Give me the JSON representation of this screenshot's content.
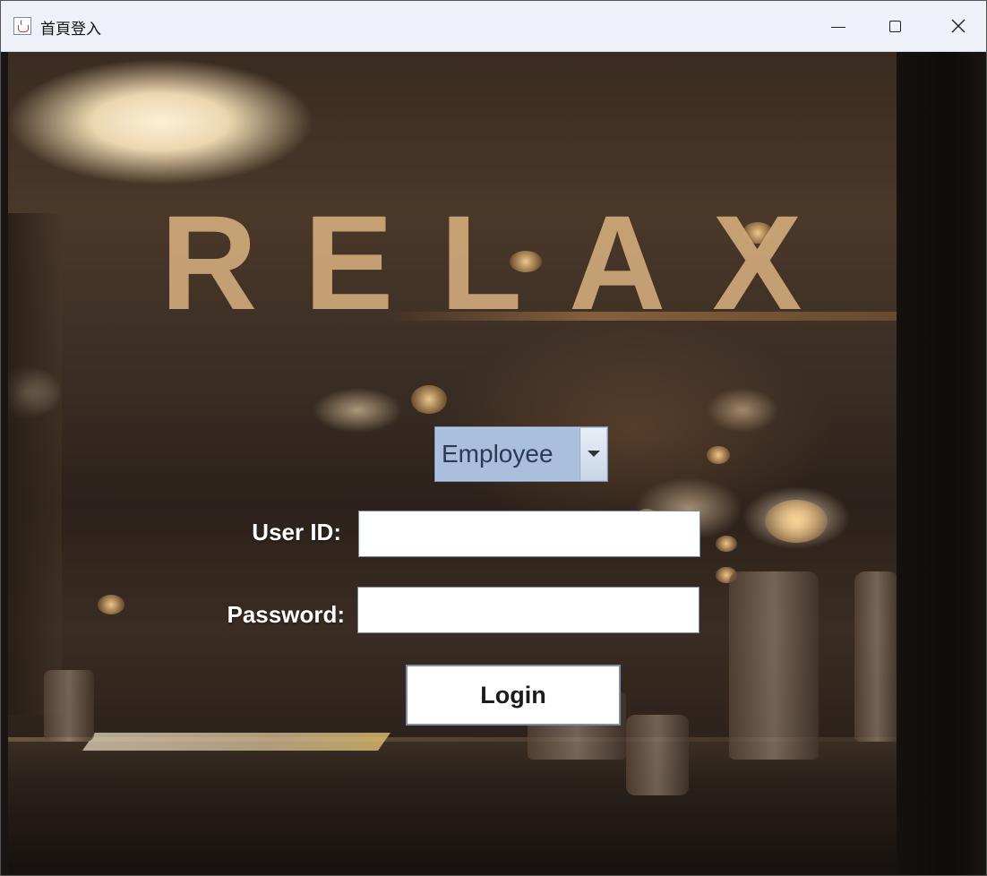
{
  "window": {
    "title": "首頁登入",
    "app_icon": "java-cup-icon",
    "controls": {
      "minimize_icon": "minimize-icon",
      "maximize_icon": "maximize-icon",
      "close_icon": "close-icon",
      "close_glyph": "✕"
    }
  },
  "background": {
    "logo_text": "RELAX",
    "logo_color": "#cfa97a"
  },
  "login_form": {
    "role_select": {
      "selected": "Employee",
      "arrow_icon": "chevron-down-icon"
    },
    "user_id": {
      "label": "User ID:",
      "value": ""
    },
    "password": {
      "label": "Password:",
      "value": ""
    },
    "login_label": "Login"
  },
  "colors": {
    "select_bg": "#a9bfdc",
    "label_text": "#ffffff",
    "button_border": "#7c8ea8"
  }
}
